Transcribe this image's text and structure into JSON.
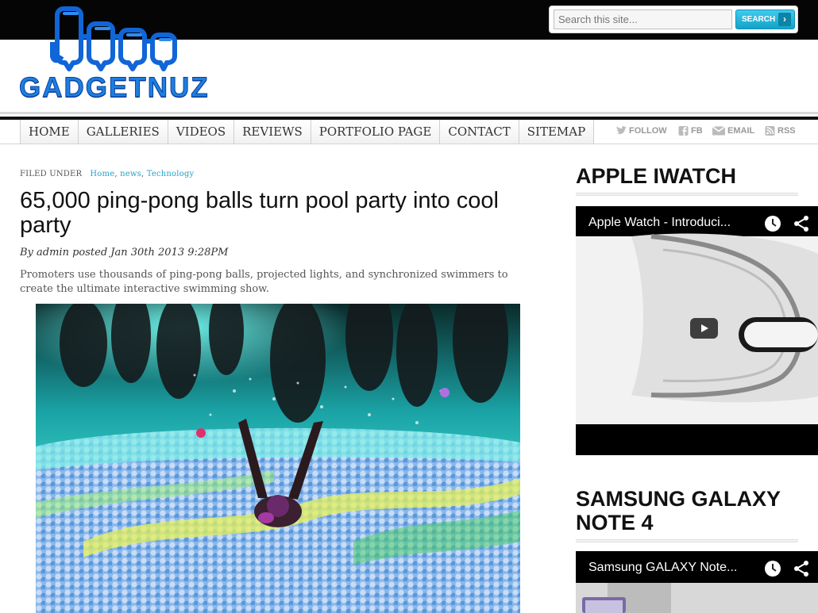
{
  "site": {
    "logo_text": "GADGETNUZ"
  },
  "search": {
    "placeholder": "Search this site...",
    "button_label": "SEARCH"
  },
  "nav": {
    "items": [
      "HOME",
      "GALLERIES",
      "VIDEOS",
      "REVIEWS",
      "PORTFOLIO PAGE",
      "CONTACT",
      "SITEMAP"
    ]
  },
  "social": {
    "follow": "FOLLOW",
    "fb": "FB",
    "email": "EMAIL",
    "rss": "RSS"
  },
  "article": {
    "filed_under_label": "FILED UNDER",
    "categories": [
      "Home",
      "news",
      "Technology"
    ],
    "title": "65,000 ping-pong balls turn pool party into cool party",
    "byline": "By admin posted Jan 30th 2013 9:28PM",
    "excerpt": "Promoters use thousands of ping-pong balls, projected lights, and synchronized swimmers to create the ultimate interactive swimming show."
  },
  "sidebar": {
    "widgets": [
      {
        "title": "APPLE IWATCH",
        "video_title": "Apple Watch - Introduci..."
      },
      {
        "title": "SAMSUNG GALAXY NOTE 4",
        "video_title": "Samsung GALAXY Note..."
      }
    ]
  },
  "colors": {
    "accent": "#22a3c9",
    "logo_blue": "#1d7fe0",
    "topbar": "#050505"
  }
}
